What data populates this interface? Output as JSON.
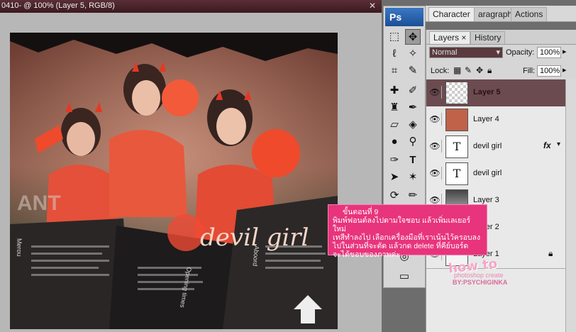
{
  "document": {
    "title": "0410- @ 100% (Layer 5, RGB/8)"
  },
  "artwork": {
    "headline": "devil girl",
    "overlay_text": "ANT",
    "newspaper": [
      "Opening times",
      "Merou",
      "Aboord",
      "devil"
    ]
  },
  "toolbar": {
    "logo": "Ps",
    "type_tool_glyph": "T"
  },
  "panels": {
    "top_tabs": [
      "Character",
      "aragraph",
      "Actions"
    ],
    "layer_tabs": [
      "Layers",
      "History"
    ],
    "layers_close": "×",
    "blend_mode": "Normal",
    "opacity_label": "Opacity:",
    "opacity_value": "100%",
    "lock_label": "Lock:",
    "fill_label": "Fill:",
    "fill_value": "100%"
  },
  "layers": [
    {
      "name": "Layer 5",
      "type": "raster",
      "selected": true
    },
    {
      "name": "Layer 4",
      "type": "color",
      "color": "#c0614a"
    },
    {
      "name": "devil girl",
      "type": "text",
      "fx": "fx"
    },
    {
      "name": "devil girl",
      "type": "text"
    },
    {
      "name": "Layer 3",
      "type": "raster"
    },
    {
      "name": "Layer 2",
      "type": "raster"
    },
    {
      "name": "Layer 1",
      "type": "raster"
    }
  ],
  "callout": {
    "lines": [
      "ขั้นตอนที่ 9",
      "พิมพ์ฟอนต์ลงไปตามใจชอบ แล้วเพิ่มเลเยอร์ใหม่",
      "เทสีทำลงไป เลือกเครื่องมือที่เราเน้นไว้ครอบลง",
      "ไปในส่วนที่จะตัด แล้วกด delete ที่คีย์บอร์ด",
      "จะได้ขอบของภาพค่ะ"
    ]
  },
  "watermark": {
    "line1": "how to",
    "line2": "photoshop create",
    "line3": "BY:PSYCHIGINKA"
  },
  "colors": {
    "callout": "#e8347c",
    "titlebar": "#4a232a",
    "selected_layer": "#6b4b4f",
    "fill_layer": "#c0614a"
  }
}
